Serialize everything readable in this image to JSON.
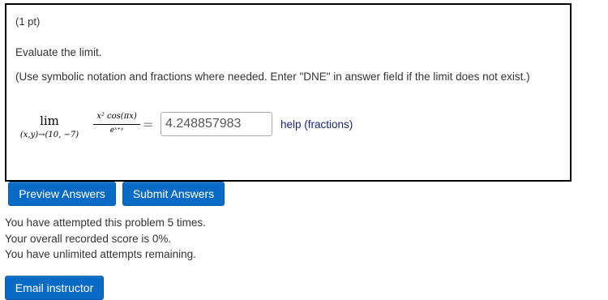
{
  "problem": {
    "points": "(1 pt)",
    "instruction": "Evaluate the limit.",
    "note": "(Use symbolic notation and fractions where needed. Enter \"DNE\" in answer field if the limit does not exist.)",
    "limit_word": "lim",
    "limit_subscript": "(x,y)→(10, −7)",
    "numerator": "x² cos(πx)",
    "denominator": "eˣ⁺ʸ",
    "equals": "=",
    "answer_value": "4.248857983",
    "help_link": "help (fractions)"
  },
  "buttons": {
    "preview": "Preview Answers",
    "submit": "Submit Answers",
    "email": "Email instructor"
  },
  "status": {
    "attempts": "You have attempted this problem 5 times.",
    "score": "Your overall recorded score is 0%.",
    "remaining": "You have unlimited attempts remaining."
  },
  "colors": {
    "button_bg": "#0a6bc6",
    "help_link": "#1a237e",
    "box_border": "#000000"
  }
}
